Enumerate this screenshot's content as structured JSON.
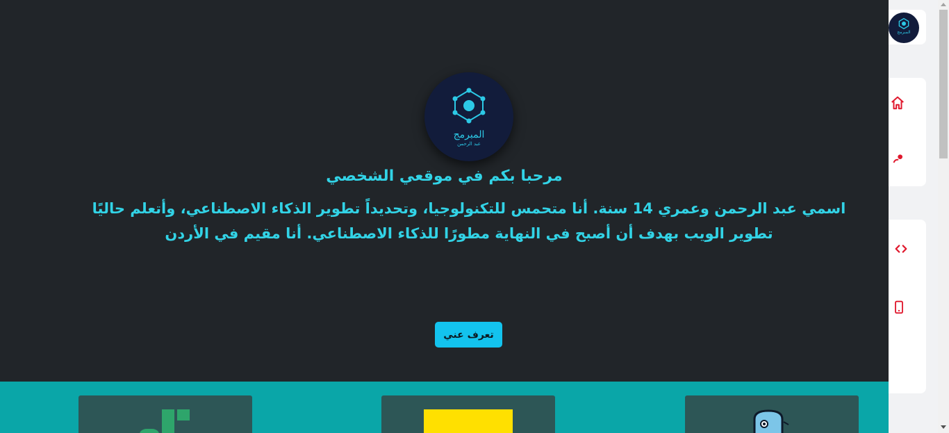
{
  "hero": {
    "logo": {
      "text": "المبرمج",
      "subtext": "عبد الرحمن"
    },
    "title": "مرحبا بكم في موقعي الشخصي",
    "bio": "اسمي عبد الرحمن وعمري 14 سنة. أنا متحمس للتكنولوجيا، وتحديداً تطوير الذكاء الاصطناعي، وأتعلم حاليًا تطوير الويب بهدف أن أصبح في النهاية مطورًا للذكاء الاصطناعي. أنا مقيم في الأردن",
    "cta_label": "تعرف عني"
  },
  "sidebar": {
    "avatar": {
      "text": "المبرمج"
    },
    "items": [
      {
        "icon": "home-icon"
      },
      {
        "icon": "user-icon"
      },
      {
        "icon": "code-icon"
      },
      {
        "icon": "phone-icon"
      }
    ]
  },
  "colors": {
    "background": "#212529",
    "accent": "#32d3e6",
    "button": "#13c3ee",
    "strip": "#0aa6a8",
    "icon": "#e0182d"
  }
}
